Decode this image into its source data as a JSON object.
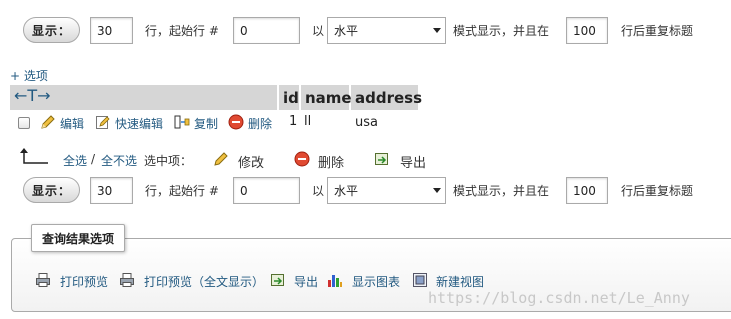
{
  "nav_top": {
    "show_button": "显示：",
    "rows_value": "30",
    "rows_label": "行，起始行 #",
    "start_value": "0",
    "mode_label": "以",
    "mode_value": "水平",
    "mode_suffix": "模式显示，并且在",
    "repeat_value": "100",
    "repeat_suffix": "行后重复标题"
  },
  "options_link": "+ 选项",
  "table": {
    "sort_arrows": "←T→",
    "headers": [
      "id",
      "name",
      "address"
    ],
    "row": {
      "edit": "编辑",
      "quick_edit": "快速编辑",
      "copy": "复制",
      "delete": "删除",
      "id": "1",
      "name": "ll",
      "address": "usa"
    }
  },
  "bulk": {
    "select_all": "全选",
    "separator": "/",
    "deselect_all": "全不选",
    "with_selected": "选中项：",
    "modify": "修改",
    "delete": "删除",
    "export": "导出"
  },
  "nav_bottom": {
    "show_button": "显示：",
    "rows_value": "30",
    "rows_label": "行，起始行 #",
    "start_value": "0",
    "mode_label": "以",
    "mode_value": "水平",
    "mode_suffix": "模式显示，并且在",
    "repeat_value": "100",
    "repeat_suffix": "行后重复标题"
  },
  "query_results": {
    "legend": "查询结果选项",
    "print_view": "打印预览",
    "print_view_full": "打印预览（全文显示）",
    "export": "导出",
    "display_chart": "显示图表",
    "create_view": "新建视图"
  },
  "watermark": "https://blog.csdn.net/Le_Anny"
}
